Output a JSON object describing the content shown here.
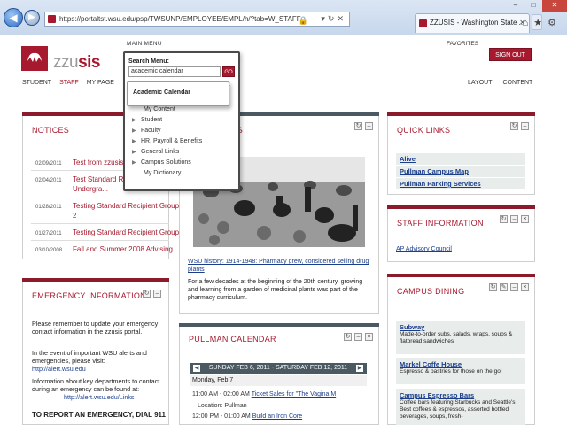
{
  "browser": {
    "url": "https://portaltst.wsu.edu/psp/TWSUNP/EMPLOYEE/EMPL/h/?tab=W_STAFF",
    "tab_title": "ZZUSIS - Washington State ...",
    "win_min": "–",
    "win_max": "□",
    "win_close": "✕",
    "tab_close": "✕"
  },
  "header": {
    "main_menu": "MAIN MENU",
    "favorites": "FAVORITES",
    "logo_prefix": "zzu",
    "logo_suffix": "sis",
    "sign_out": "SIGN OUT",
    "nav": [
      "STUDENT",
      "STAFF",
      "MY PAGE"
    ],
    "nav_right": [
      "LAYOUT",
      "CONTENT"
    ]
  },
  "menu": {
    "search_label": "Search Menu:",
    "search_value": "academic calendar",
    "go": "GO",
    "suggestion": "Academic Calendar",
    "items": [
      {
        "label": "My Content",
        "arrow": false
      },
      {
        "label": "Student",
        "arrow": true
      },
      {
        "label": "Faculty",
        "arrow": true
      },
      {
        "label": "HR, Payroll & Benefits",
        "arrow": true
      },
      {
        "label": "General Links",
        "arrow": true
      },
      {
        "label": "Campus Solutions",
        "arrow": true
      },
      {
        "label": "My Dictionary",
        "arrow": false
      }
    ]
  },
  "notices": {
    "title": "NOTICES",
    "rows": [
      {
        "date": "02/09/2011",
        "text": "Test from zzusis"
      },
      {
        "date": "02/04/2011",
        "text": "Test Standard R"
      },
      {
        "date": "",
        "text": "Undergra..."
      },
      {
        "date": "01/28/2011",
        "text": "Testing Standard Recipient Group"
      },
      {
        "date": "",
        "text": "2"
      },
      {
        "date": "01/27/2011",
        "text": "Testing Standard Recipient Group"
      },
      {
        "date": "03/10/2008",
        "text": "Fall and Summer 2008 Advising"
      }
    ]
  },
  "emergency": {
    "title": "EMERGENCY INFORMATION",
    "p1": "Please remember to update your emergency contact information in the zzusis portal.",
    "p2": "In the event of important WSU alerts and emergencies, please visit:",
    "link1": "http://alert.wsu.edu",
    "p3": "Information about key departments to contact during an emergency can be found at:",
    "link2": "http://alert.wsu.edu/Links",
    "bold": "TO REPORT AN EMERGENCY, DIAL 911"
  },
  "news": {
    "title_tail": "WS",
    "caption": "WSU history: 1914-1948: Pharmacy grew, considered selling drug plants",
    "body": "For a few decades at the beginning of the 20th century, growing and learning from a garden of medicinal plants was part of the pharmacy curriculum."
  },
  "calendar": {
    "title": "PULLMAN CALENDAR",
    "range": "SUNDAY FEB 6, 2011 - SATURDAY FEB 12, 2011",
    "day": "Monday, Feb 7",
    "events": [
      {
        "time": "11:00 AM - 02:00 AM",
        "title": "Ticket Sales for \"The Vagina M"
      },
      {
        "time": "Location: Pullman",
        "title": ""
      },
      {
        "time": "12:00 PM - 01:00 AM",
        "title": "Build an Iron Core"
      }
    ]
  },
  "quick_links": {
    "title": "QUICK LINKS",
    "items": [
      "Alive",
      "Pullman Campus Map",
      "Pullman Parking Services"
    ]
  },
  "staff_info": {
    "title": "STAFF INFORMATION",
    "link": "AP Advisory Council"
  },
  "dining": {
    "title": "CAMPUS DINING",
    "items": [
      {
        "name": "Subway",
        "desc": "Made-to-order subs, salads, wraps, soups & flatbread sandwiches"
      },
      {
        "name": "Markel Coffe House",
        "desc": "Espresso & pastries for those on the go!"
      },
      {
        "name": "Campus Espresso Bars",
        "desc": "Coffee bars featuring Starbucks and Seattle's Best coffees & espressos, assorted bottled beverages, soups, fresh-"
      }
    ]
  },
  "colors": {
    "crimson": "#a6192e",
    "slate": "#4b5a62",
    "link": "#1a3e8c"
  }
}
